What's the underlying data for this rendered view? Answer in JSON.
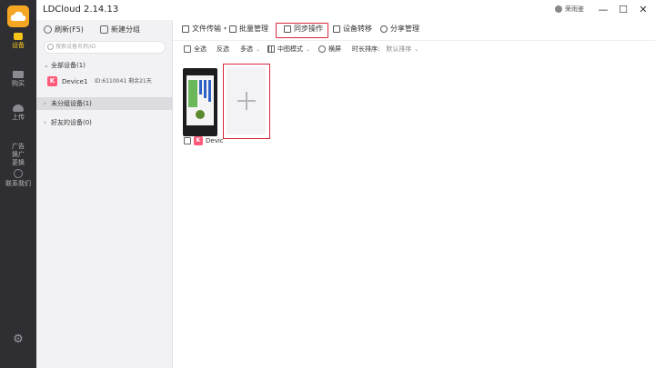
{
  "app": {
    "title": "LDCloud 2.14.13",
    "user": "荣雨鉴"
  },
  "window_controls": {
    "min": "—",
    "max": "☐",
    "close": "✕"
  },
  "rail": {
    "items": [
      {
        "label": "设备",
        "active": true
      },
      {
        "label": "购买",
        "active": false
      },
      {
        "label": "上传",
        "active": false
      },
      {
        "label": "广告\n换广\n更换",
        "active": false
      },
      {
        "label": "联系我们",
        "active": false
      }
    ],
    "settings": "⚙"
  },
  "device_panel": {
    "refresh": "刷新(F5)",
    "new_group": "新建分组",
    "search_placeholder": "搜索设备名称/ID",
    "groups": {
      "all": "全部设备(1)",
      "ungrouped": "未分组设备(1)",
      "friends": "好友的设备(0)"
    },
    "device": {
      "name": "Device1",
      "id": "ID:6110041",
      "remaining": "剩余21天"
    }
  },
  "toolbar": {
    "file_transfer": "文件传输",
    "batch_manage": "批量管理",
    "sync_op": "同步操作",
    "device_transfer": "设备转移",
    "share_manage": "分享管理"
  },
  "subbar": {
    "select_all": "全选",
    "invert": "反选",
    "multi": "多选",
    "view_mode": "中图模式",
    "landscape": "横屏",
    "sort_label": "时长排序:",
    "sort_value": "默认排序"
  },
  "card": {
    "label": "Devic"
  },
  "colors": {
    "accent": "#f5a623",
    "highlight": "#d7263d",
    "badge": "#ff5a7a"
  }
}
